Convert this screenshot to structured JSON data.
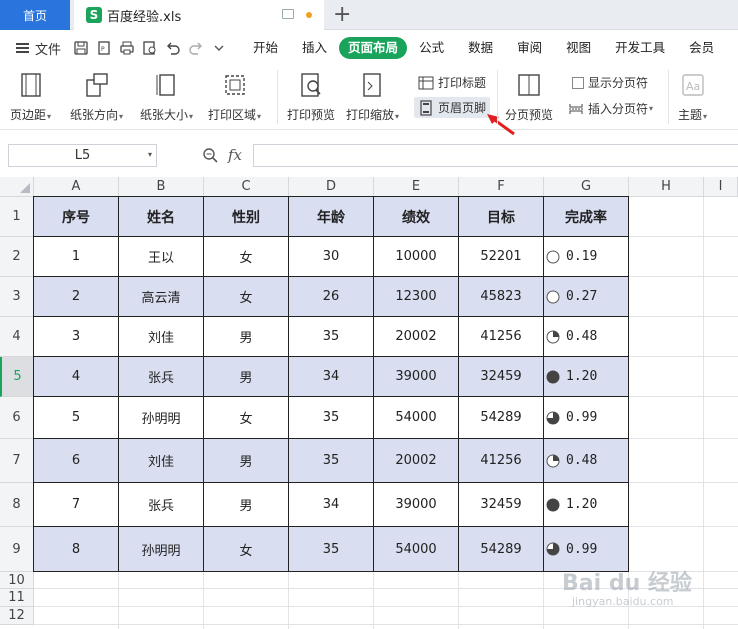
{
  "tabs": {
    "home": "首页",
    "file": "百度经验.xls"
  },
  "menu": {
    "file_label": "文件",
    "tabs": [
      "开始",
      "插入",
      "页面布局",
      "公式",
      "数据",
      "审阅",
      "视图",
      "开发工具",
      "会员"
    ],
    "active_tab": "页面布局"
  },
  "ribbon": {
    "margins": "页边距",
    "orientation": "纸张方向",
    "size": "纸张大小",
    "print_area": "打印区域",
    "print_preview": "打印预览",
    "print_scale": "打印缩放",
    "print_titles": "打印标题",
    "header_footer": "页眉页脚",
    "page_break_preview": "分页预览",
    "show_page_breaks": "显示分页符",
    "insert_page_break": "插入分页符",
    "theme": "主题"
  },
  "formula_bar": {
    "cell_ref": "L5",
    "fx": "fx",
    "value": ""
  },
  "columns": [
    "A",
    "B",
    "C",
    "D",
    "E",
    "F",
    "G",
    "H",
    "I"
  ],
  "rows": [
    "1",
    "2",
    "3",
    "4",
    "5",
    "6",
    "7",
    "8",
    "9",
    "10",
    "11",
    "12"
  ],
  "selected_row": "5",
  "table": {
    "headers": [
      "序号",
      "姓名",
      "性别",
      "年龄",
      "绩效",
      "目标",
      "完成率"
    ],
    "rows": [
      [
        "1",
        "王以",
        "女",
        "30",
        "10000",
        "52201",
        "0.19"
      ],
      [
        "2",
        "高云清",
        "女",
        "26",
        "12300",
        "45823",
        "0.27"
      ],
      [
        "3",
        "刘佳",
        "男",
        "35",
        "20002",
        "41256",
        "0.48"
      ],
      [
        "4",
        "张兵",
        "男",
        "34",
        "39000",
        "32459",
        "1.20"
      ],
      [
        "5",
        "孙明明",
        "女",
        "35",
        "54000",
        "54289",
        "0.99"
      ],
      [
        "6",
        "刘佳",
        "男",
        "35",
        "20002",
        "41256",
        "0.48"
      ],
      [
        "7",
        "张兵",
        "男",
        "34",
        "39000",
        "32459",
        "1.20"
      ],
      [
        "8",
        "孙明明",
        "女",
        "35",
        "54000",
        "54289",
        "0.99"
      ]
    ],
    "rate_icon_levels": [
      0,
      0,
      0.25,
      1,
      0.75,
      0.25,
      1,
      0.75
    ]
  },
  "colors": {
    "accent": "#1aa35a",
    "home_tab": "#2a74de",
    "band": "#d9def0",
    "arrow": "#e02020"
  }
}
